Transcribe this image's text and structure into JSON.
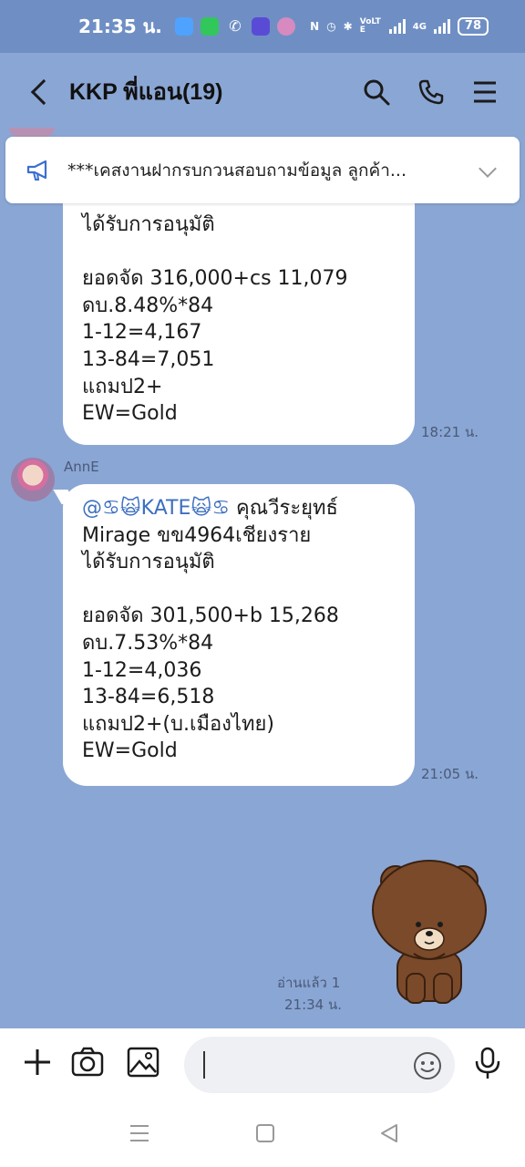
{
  "status_bar": {
    "time": "21:35 น.",
    "network": "4G",
    "volte": "VoLTE",
    "battery": "78"
  },
  "header": {
    "title": "KKP พี่แอน(19)"
  },
  "announcement": {
    "text": "***เคสงานฝากรบกวนสอบถามข้อมูล ลูกค้า..."
  },
  "messages": [
    {
      "lines": [
        "ได้รับการอนุมัติ",
        "",
        "ยอดจัด 316,000+cs 11,079",
        "ดบ.8.48%*84",
        "1-12=4,167",
        "13-84=7,051",
        "แถมป2+",
        "EW=Gold"
      ],
      "time": "18:21 น."
    },
    {
      "sender": "AnnE",
      "mention": "@♋🙀KATE🙀♋",
      "mention_rest": " คุณวีระยุทธ์",
      "lines": [
        "Mirage ขข4964เชียงราย",
        "ได้รับการอนุมัติ",
        "",
        "ยอดจัด 301,500+b 15,268",
        "ดบ.7.53%*84",
        "1-12=4,036",
        "13-84=6,518",
        "แถมป2+(บ.เมืองไทย)",
        "EW=Gold"
      ],
      "time": "21:05 น."
    }
  ],
  "sent": {
    "read_status": "อ่านแล้ว 1",
    "time": "21:34 น."
  },
  "input": {
    "value": "",
    "placeholder": ""
  }
}
